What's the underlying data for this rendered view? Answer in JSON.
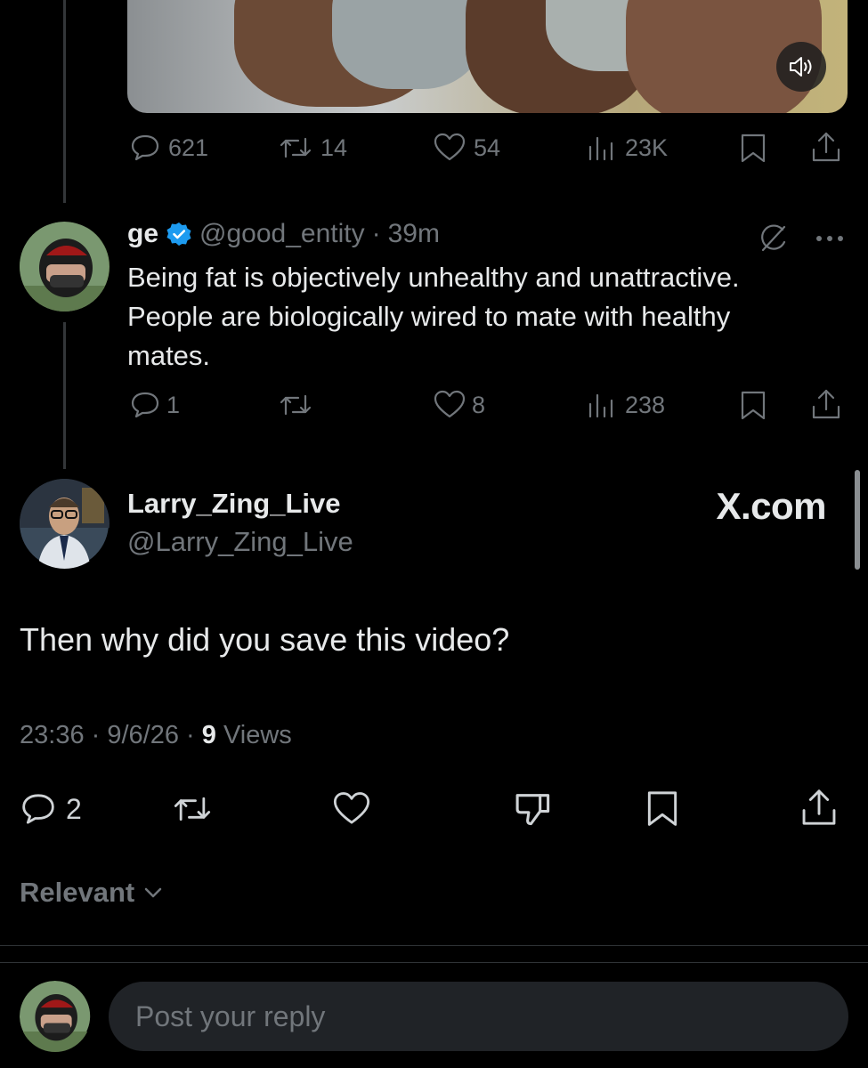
{
  "tweet1": {
    "stats": {
      "replies": "621",
      "reposts": "14",
      "likes": "54",
      "views": "23K"
    }
  },
  "tweet2": {
    "display_name": "ge",
    "handle": "@good_entity",
    "sep": "·",
    "time": "39m",
    "text_line1": "Being fat is objectively unhealthy and unattractive.",
    "text_line2": "People are biologically wired to mate with healthy",
    "text_line3": "mates.",
    "stats": {
      "replies": "1",
      "likes": "8",
      "views": "238"
    }
  },
  "main_tweet": {
    "display_name": "Larry_Zing_Live",
    "handle": "@Larry_Zing_Live",
    "watermark": "X.com",
    "text": "Then why did you save this video?",
    "timestamp": "23:36 · 9/6/26 · ",
    "views_count": "9",
    "views_label": " Views",
    "replies": "2"
  },
  "sort": {
    "label": "Relevant"
  },
  "reply": {
    "placeholder": "Post your reply"
  },
  "colors": {
    "background": "#000000",
    "verified": "#1d9bf0",
    "muted": "#71767b",
    "text": "#e7e9ea"
  }
}
